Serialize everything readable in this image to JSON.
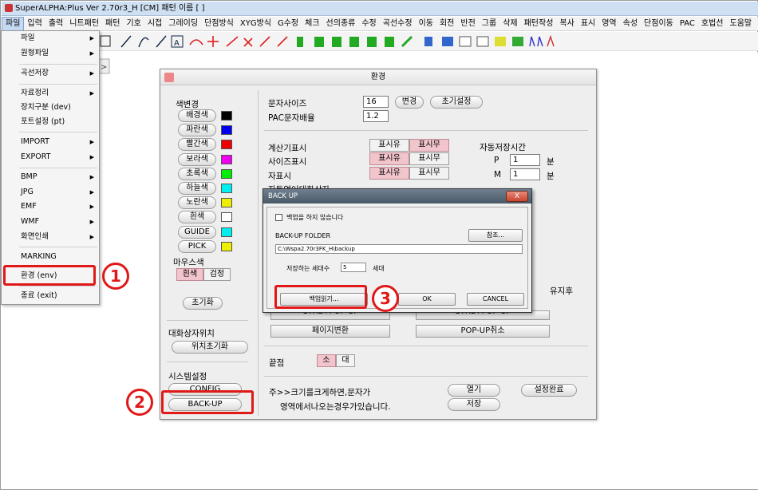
{
  "window": {
    "title": "SuperALPHA:Plus Ver 2.70r3_H [CM]   패턴 이름   [  ]"
  },
  "menubar": [
    "파일",
    "입력",
    "출력",
    "니트패턴",
    "패턴",
    "기호",
    "시접",
    "그레이딩",
    "단점방식",
    "XYG방식",
    "G수정",
    "체크",
    "선의종류",
    "수정",
    "곡선수정",
    "이동",
    "회전",
    "반전",
    "그룹",
    "삭제",
    "패턴작성",
    "복사",
    "표시",
    "영역",
    "속성",
    "단점이동",
    "PAC",
    "호법선",
    "도움말"
  ],
  "file_menu": {
    "items": [
      {
        "label": "파일",
        "submenu": true
      },
      {
        "label": "원형파일",
        "submenu": true
      },
      {
        "label": "곡선저장",
        "submenu": true
      },
      {
        "label": "자료정리",
        "submenu": true
      },
      {
        "label": "장치구분 (dev)",
        "submenu": false
      },
      {
        "label": "포트설정 (pt)",
        "submenu": false
      },
      {
        "label": "IMPORT",
        "submenu": true
      },
      {
        "label": "EXPORT",
        "submenu": true
      },
      {
        "label": "BMP",
        "submenu": true
      },
      {
        "label": "JPG",
        "submenu": true
      },
      {
        "label": "EMF",
        "submenu": true
      },
      {
        "label": "WMF",
        "submenu": true
      },
      {
        "label": "화면인쇄",
        "submenu": true
      },
      {
        "label": "MARKING",
        "submenu": false
      },
      {
        "label": "환경 (env)",
        "submenu": false
      },
      {
        "label": "종료 (exit)",
        "submenu": false
      }
    ]
  },
  "callouts": {
    "one": "1",
    "two": "2",
    "three": "3"
  },
  "env_dialog": {
    "title": "환경",
    "color_change_label": "색변경",
    "colors": [
      {
        "label": "배경색",
        "color": "#000000"
      },
      {
        "label": "파란색",
        "color": "#0000ee"
      },
      {
        "label": "빨간색",
        "color": "#ee0000"
      },
      {
        "label": "보라색",
        "color": "#ee00ee"
      },
      {
        "label": "초록색",
        "color": "#00ee00"
      },
      {
        "label": "하늘색",
        "color": "#00eeee"
      },
      {
        "label": "노란색",
        "color": "#eeee00"
      },
      {
        "label": "흰색",
        "color": "#ffffff"
      },
      {
        "label": "GUIDE",
        "color": "#00eeee"
      },
      {
        "label": "PICK",
        "color": "#eeee00"
      }
    ],
    "mouse_color_label": "마우스색",
    "mouse_white": "흰색",
    "mouse_black": "검정",
    "reset": "초기화",
    "dialog_pos_label": "대화상자위치",
    "pos_reset": "위치초기화",
    "system_label": "시스템설정",
    "config": "CONFIG",
    "backup": "BACK-UP",
    "char_size_label": "문자사이즈",
    "char_size_value": "16",
    "change": "변경",
    "default_setting": "초기설정",
    "pac_ratio_label": "PAC문자배율",
    "pac_ratio_value": "1.2",
    "calc_label": "계산기표시",
    "size_label": "사이즈표시",
    "ruler_label": "자표시",
    "dialog_bg_label": "자동열어대화상자",
    "show_yes": "표시유",
    "show_no": "표시무",
    "autosave_label": "자동저장시간",
    "p_label": "P",
    "p_value": "1",
    "m_label": "M",
    "m_value": "1",
    "min_unit": "분",
    "after_label": "유지후",
    "ctrl_popup_left": "CTRL+POP-UP",
    "ctrl_popup_right": "CTRL+POP-UP",
    "page_switch": "페이지변환",
    "popup_cancel": "POP-UP취소",
    "endpoint_label": "끝점",
    "small": "소",
    "large": "대",
    "note_line1": "주>>크기를크게하면,문자가",
    "note_line2": "영역에서나오는경우가있습니다.",
    "open": "열기",
    "save": "저장",
    "done": "설정완료"
  },
  "backup_dialog": {
    "title": "BACK UP",
    "close": "X",
    "no_backup_label": "백업을 하지 않습니다",
    "folder_label": "BACK-UP FOLDER",
    "browse": "참조...",
    "folder_value": "C:\\Wspa2.70r3FK_H\\backup",
    "generations_label": "저장하는 세대수",
    "generations_value": "5",
    "generations_unit": "세대",
    "read_backup": "백업읽기...",
    "ok": "OK",
    "cancel": "CANCEL"
  }
}
